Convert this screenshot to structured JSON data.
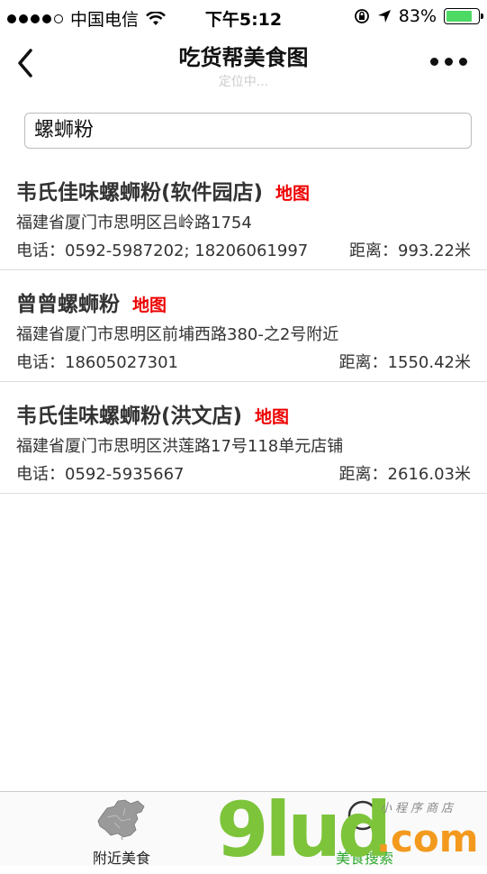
{
  "status": {
    "carrier": "中国电信",
    "time": "下午5:12",
    "battery": "83%",
    "battery_level": 0.83,
    "battery_color": "#4cd964"
  },
  "nav": {
    "title": "吃货帮美食图",
    "subtitle": "定位中..."
  },
  "search": {
    "value": "螺蛳粉"
  },
  "results": [
    {
      "name": "韦氏佳味螺蛳粉(软件园店)",
      "map_label": "地图",
      "address": "福建省厦门市思明区吕岭路1754",
      "phone": "电话：0592-5987202; 18206061997",
      "distance": "距离：993.22米"
    },
    {
      "name": "曾曾螺蛳粉",
      "map_label": "地图",
      "address": "福建省厦门市思明区前埔西路380-之2号附近",
      "phone": "电话：18605027301",
      "distance": "距离：1550.42米"
    },
    {
      "name": "韦氏佳味螺蛳粉(洪文店)",
      "map_label": "地图",
      "address": "福建省厦门市思明区洪莲路17号118单元店铺",
      "phone": "电话：0592-5935667",
      "distance": "距离：2616.03米"
    }
  ],
  "tabbar": {
    "tab1": {
      "label": "附近美食",
      "icon": "china-map-icon"
    },
    "tab2": {
      "label": "美食搜索",
      "icon": "search-icon",
      "active_color": "#2ea82e"
    }
  },
  "watermark": {
    "main": "9lud",
    "suffix": ".com",
    "tagline": "小程序商店"
  }
}
